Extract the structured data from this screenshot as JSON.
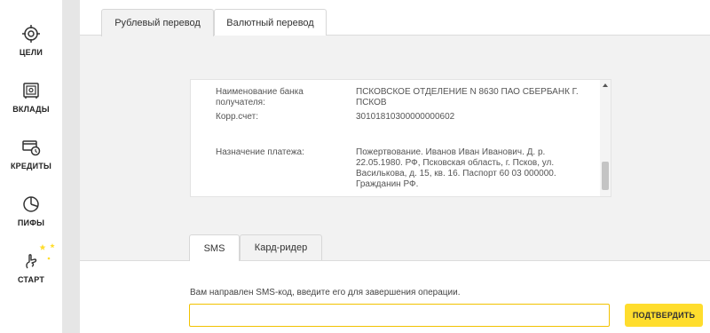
{
  "sidebar": {
    "items": [
      {
        "label": "ЦЕЛИ",
        "icon": "target-icon"
      },
      {
        "label": "ВКЛАДЫ",
        "icon": "safe-icon"
      },
      {
        "label": "КРЕДИТЫ",
        "icon": "credit-card-icon"
      },
      {
        "label": "ПИФЫ",
        "icon": "pie-chart-icon"
      },
      {
        "label": "СТАРТ",
        "icon": "start-hand-icon"
      }
    ]
  },
  "transfer_tabs": [
    {
      "label": "Рублевый перевод",
      "active": true
    },
    {
      "label": "Валютный перевод",
      "active": false
    }
  ],
  "details": {
    "bank_name_label": "Наименование банка получателя:",
    "bank_name_value": "ПСКОВСКОЕ ОТДЕЛЕНИЕ N 8630 ПАО СБЕРБАНК Г. ПСКОВ",
    "corr_account_label": "Корр.счет:",
    "corr_account_value": "30101810300000000602",
    "purpose_label": "Назначение платежа:",
    "purpose_value": "Пожертвование. Иванов Иван Иванович. Д. р. 22.05.1980. РФ, Псковская область, г. Псков, ул. Василькова, д. 15, кв. 16. Паспорт 60 03 000000. Гражданин РФ."
  },
  "auth_tabs": [
    {
      "label": "SMS",
      "active": true
    },
    {
      "label": "Кард-ридер",
      "active": false
    }
  ],
  "sms": {
    "note": "Вам направлен SMS-код, введите его для завершения операции.",
    "input_value": "",
    "confirm_label": "ПОДТВЕРДИТЬ"
  },
  "colors": {
    "accent": "#ffdd2d",
    "star": "#ffdd2d"
  }
}
